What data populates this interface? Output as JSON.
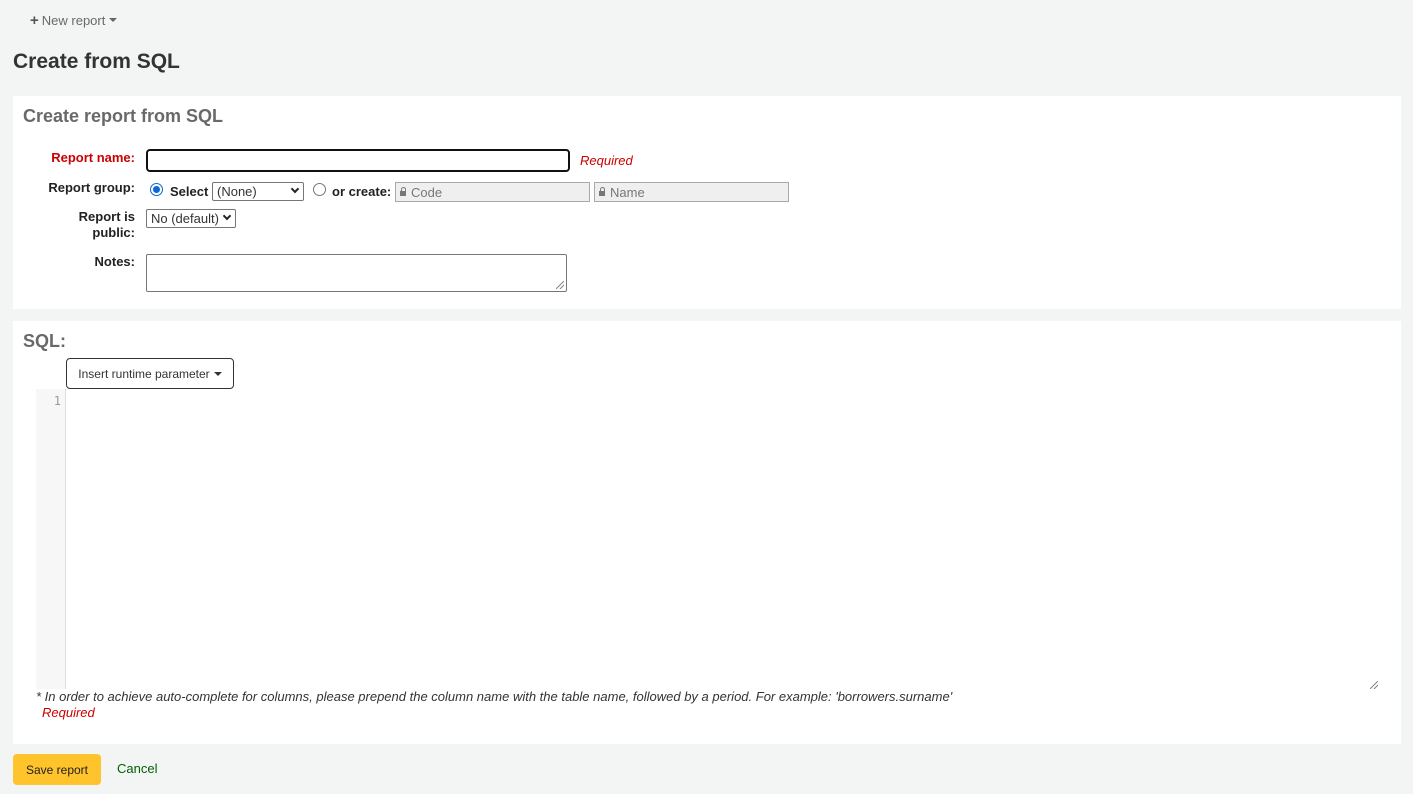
{
  "toolbar": {
    "new_report_label": "New report"
  },
  "page_title": "Create from SQL",
  "form": {
    "section_title": "Create report from SQL",
    "report_name": {
      "label": "Report name:",
      "value": "",
      "required_text": "Required"
    },
    "report_group": {
      "label": "Report group:",
      "select_option_label": "Select",
      "selected_value": "(None)",
      "create_option_label": "or create:",
      "code_placeholder": "Code",
      "name_placeholder": "Name",
      "mode": "select"
    },
    "report_public": {
      "label_line1": "Report is",
      "label_line2": "public:",
      "selected_value": "No (default)"
    },
    "notes": {
      "label": "Notes:",
      "value": ""
    }
  },
  "sql": {
    "section_title": "SQL:",
    "insert_param_label": "Insert runtime parameter",
    "line_numbers": [
      "1"
    ],
    "value": "",
    "hint": "* In order to achieve auto-complete for columns, please prepend the column name with the table name, followed by a period. For example: 'borrowers.surname'",
    "required_text": "Required"
  },
  "actions": {
    "save_label": "Save report",
    "cancel_label": "Cancel"
  },
  "colors": {
    "required": "#cc0000",
    "save_button": "#ffc32b",
    "cancel_link": "#006100",
    "radio_accent": "#0b69d6"
  }
}
